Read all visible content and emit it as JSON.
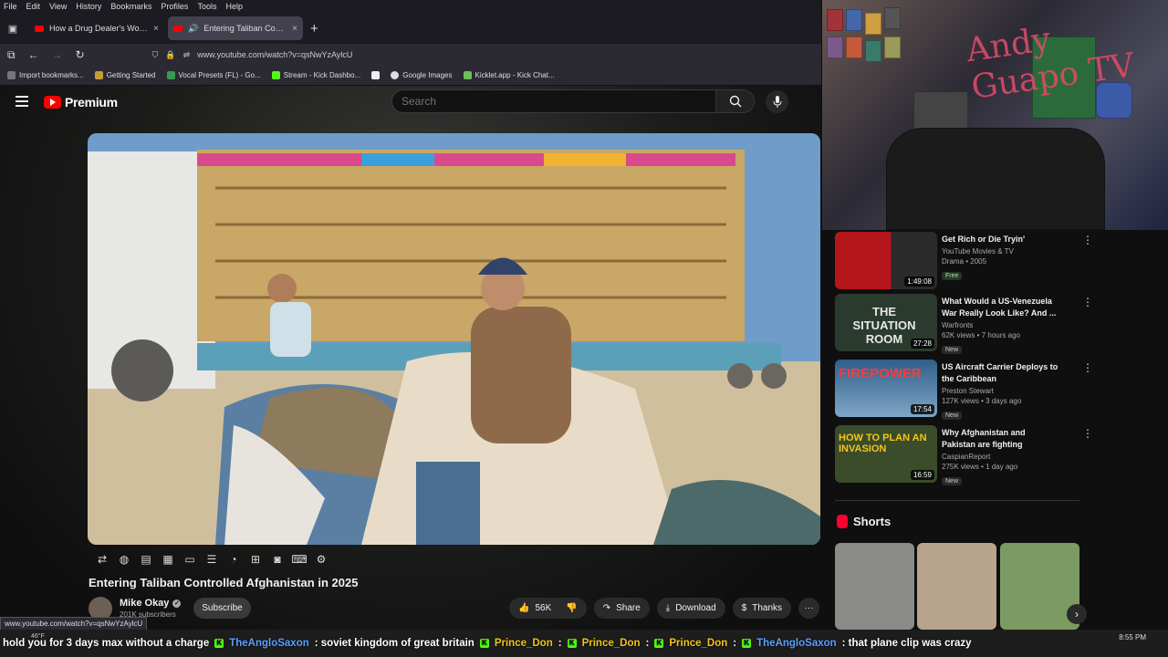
{
  "browser": {
    "menu": [
      "File",
      "Edit",
      "View",
      "History",
      "Bookmarks",
      "Profiles",
      "Tools",
      "Help"
    ],
    "tabs": [
      {
        "title": "How a Drug Dealer's Worst Nig",
        "close": "×"
      },
      {
        "title": "Entering Taliban Controlled",
        "close": "×"
      }
    ],
    "new_tab": "+",
    "url": "www.youtube.com/watch?v=qsNwYzAylcU",
    "bookmarks": [
      "Import bookmarks...",
      "Getting Started",
      "Vocal Presets (FL) - Go...",
      "Stream - Kick Dashbo...",
      "",
      "Google Images",
      "Kicklet.app - Kick Chat..."
    ],
    "status_url": "www.youtube.com/watch?v=qsNwYzAylcU"
  },
  "youtube": {
    "logo": "Premium",
    "search_placeholder": "Search",
    "video": {
      "title": "Entering Taliban Controlled Afghanistan in 2025",
      "channel": "Mike Okay",
      "subscribers": "201K subscribers",
      "subscribe": "Subscribe",
      "likes": "56K",
      "share": "Share",
      "download": "Download",
      "thanks": "Thanks",
      "more": "···"
    },
    "recommendations": [
      {
        "title": "Get Rich or Die Tryin'",
        "channel": "YouTube Movies & TV",
        "detail": "Drama • 2005",
        "badge": "Free",
        "duration": "1:49:08",
        "thumb_text": "",
        "thumb_color": "#b5161c"
      },
      {
        "title": "What Would a US-Venezuela War Really Look Like? And ...",
        "channel": "Warfronts",
        "detail": "62K views • 7 hours ago",
        "badge": "New",
        "duration": "27:28",
        "thumb_text": "THE SITUATION ROOM",
        "thumb_color": "#2b3a2e"
      },
      {
        "title": "US Aircraft Carrier Deploys to the Caribbean",
        "channel": "Preston Stewart",
        "detail": "127K views • 3 days ago",
        "badge": "New",
        "duration": "17:54",
        "thumb_text": "FIREPOWER",
        "thumb_color": "#2f5f8a"
      },
      {
        "title": "Why Afghanistan and Pakistan are fighting",
        "channel": "CaspianReport",
        "detail": "275K views • 1 day ago",
        "badge": "New",
        "duration": "16:59",
        "thumb_text": "HOW TO PLAN AN INVASION",
        "thumb_color": "#3b4c2a"
      }
    ],
    "shorts_label": "Shorts",
    "shorts_colors": [
      "#8a8a86",
      "#b8a48c",
      "#7b9b62"
    ]
  },
  "chat_ticker": [
    {
      "user": "",
      "text": "hold you for 3 days max without a charge"
    },
    {
      "user": "TheAngloSaxon",
      "text": ": soviet kingdom of great britain"
    },
    {
      "user": "Prince_Don",
      "text": ":"
    },
    {
      "user": "Prince_Don",
      "text": ":"
    },
    {
      "user": "Prince_Don",
      "text": ":"
    },
    {
      "user": "TheAngloSaxon",
      "text": ": that plane clip was crazy"
    }
  ],
  "taskbar": {
    "temp": "46°F",
    "time": "8:55 PM"
  },
  "webcam_text": "Andy Guapo TV",
  "colors": {
    "yt_red": "#ff0000",
    "kick_green": "#53fc18",
    "chat_blue": "#5aa0ff",
    "chat_gold": "#f2c31a"
  }
}
